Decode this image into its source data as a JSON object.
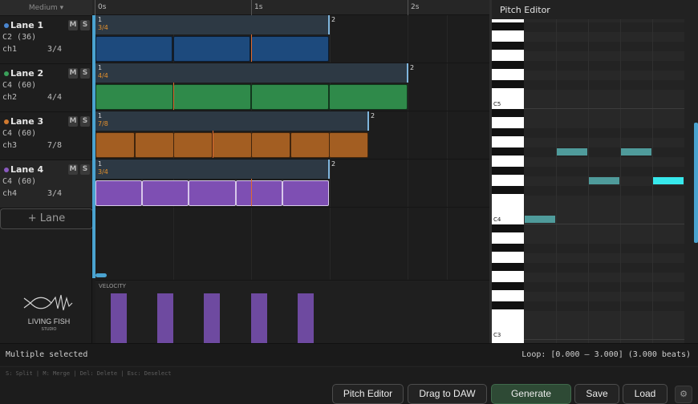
{
  "header": {
    "zoom_label": "Medium ▾"
  },
  "lanes": [
    {
      "name": "Lane 1",
      "note": "C2 (36)",
      "channel": "ch1",
      "signature": "3/4",
      "color": "#3a6fb0",
      "mute": "M",
      "solo": "S"
    },
    {
      "name": "Lane 2",
      "note": "C4 (60)",
      "channel": "ch2",
      "signature": "4/4",
      "color": "#3aa05a",
      "mute": "M",
      "solo": "S"
    },
    {
      "name": "Lane 3",
      "note": "C4 (60)",
      "channel": "ch3",
      "signature": "7/8",
      "color": "#d07a30",
      "mute": "M",
      "solo": "S"
    },
    {
      "name": "Lane 4",
      "note": "C4 (60)",
      "channel": "ch4",
      "signature": "3/4",
      "color": "#8a5ac0",
      "mute": "M",
      "solo": "S"
    }
  ],
  "add_lane_label": "+ Lane",
  "ruler": {
    "labels": [
      "0s",
      "1s",
      "2s"
    ]
  },
  "tracks": [
    {
      "loop_start": "1",
      "loop_end": "2",
      "signature": "3/4",
      "fill": "#1d4a7d",
      "notes": 3
    },
    {
      "loop_start": "1",
      "loop_end": "2",
      "signature": "4/4",
      "fill": "#2f8a4a",
      "notes": 4
    },
    {
      "loop_start": "1",
      "loop_end": "2",
      "signature": "7/8",
      "fill": "#a35e22",
      "notes": 7
    },
    {
      "loop_start": "1",
      "loop_end": "2",
      "signature": "3/4",
      "fill": "#7e4fb3",
      "notes": 5
    }
  ],
  "velocity": {
    "label": "VELOCITY",
    "bars": 5,
    "color": "#6e4aa0"
  },
  "logo": {
    "name": "LIVING FISH",
    "sub": "STUDIO"
  },
  "pitch_editor": {
    "title": "Pitch Editor",
    "key_labels": [
      "C5",
      "C4",
      "C3"
    ]
  },
  "status": {
    "left": "Multiple selected",
    "right": "Loop: [0.000 – 3.000] (3.000 beats)"
  },
  "hints": "S: Split | M: Merge | Del: Delete | Esc: Deselect",
  "buttons": {
    "pitch_editor": "Pitch Editor",
    "drag_to_daw": "Drag to DAW",
    "generate": "Generate",
    "save": "Save",
    "load": "Load",
    "settings": "⚙"
  }
}
